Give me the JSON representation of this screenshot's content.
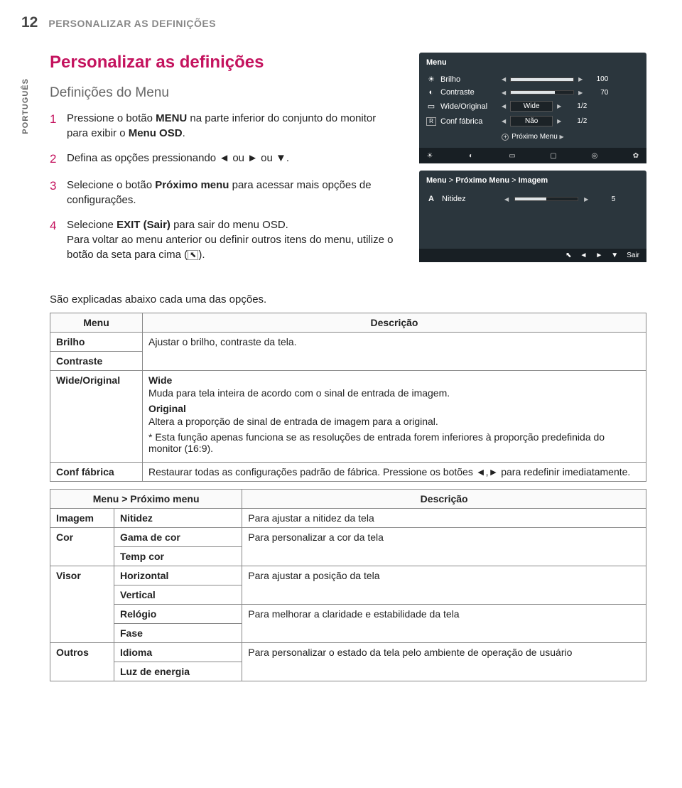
{
  "page": {
    "number": "12",
    "section": "PERSONALIZAR AS DEFINIÇÕES",
    "vertical_tab": "PORTUGUÊS"
  },
  "headings": {
    "main": "Personalizar as definições",
    "sub": "Definições do Menu"
  },
  "steps": {
    "s1": {
      "num": "1",
      "text_a": "Pressione o botão ",
      "btn": "MENU",
      "text_b": " na parte inferior do conjunto do monitor para exibir o ",
      "osd": "Menu OSD",
      "text_c": "."
    },
    "s2": {
      "num": "2",
      "text": "Defina as opções pressionando ◄ ou ► ou ▼."
    },
    "s3": {
      "num": "3",
      "text_a": "Selecione o botão ",
      "btn": "Próximo menu",
      "text_b": " para acessar mais opções de configurações."
    },
    "s4": {
      "num": "4",
      "text_a": "Selecione ",
      "btn": "EXIT (Sair)",
      "text_b": " para sair do menu OSD.",
      "text_c": "Para voltar ao menu anterior ou definir outros itens do menu, utilize o botão da seta para cima (",
      "text_d": ")."
    }
  },
  "osd1": {
    "title": "Menu",
    "rows": {
      "brilho": {
        "label": "Brilho",
        "value": "100",
        "fill_pct": 100
      },
      "contraste": {
        "label": "Contraste",
        "value": "70",
        "fill_pct": 70
      },
      "wide": {
        "label": "Wide/Original",
        "pill": "Wide",
        "value": "1/2"
      },
      "reset": {
        "icon": "R",
        "label": "Conf fábrica",
        "pill": "Não",
        "value": "1/2"
      }
    },
    "next": "Próximo Menu"
  },
  "osd2": {
    "crumb": {
      "a": "Menu",
      "b": "Próximo Menu",
      "c": "Imagem"
    },
    "row": {
      "icon": "A",
      "label": "Nitidez",
      "value": "5",
      "fill_pct": 50
    },
    "nav_exit": "Sair"
  },
  "lead": "São explicadas abaixo cada uma das opções.",
  "table1": {
    "headers": {
      "menu": "Menu",
      "desc": "Descrição"
    },
    "brilho": "Brilho",
    "contraste": "Contraste",
    "brightness_desc": "Ajustar o brilho, contraste da tela.",
    "wide": "Wide/Original",
    "wide_block": {
      "h1": "Wide",
      "p1": "Muda para tela inteira de acordo com o sinal de entrada de imagem.",
      "h2": "Original",
      "p2": "Altera a proporção de sinal de entrada de imagem para a original.",
      "p3": "* Esta função apenas funciona se as resoluções de entrada forem inferiores à proporção predefinida do monitor (16:9)."
    },
    "conf": "Conf fábrica",
    "conf_desc": "Restaurar todas as configurações padrão de fábrica. Pressione os botões ◄,► para redefinir imediatamente."
  },
  "table2": {
    "headers": {
      "menu": "Menu > Próximo menu",
      "desc": "Descrição"
    },
    "rows": {
      "imagem": {
        "cat": "Imagem",
        "s1": "Nitidez",
        "d": "Para ajustar a nitidez da tela"
      },
      "cor": {
        "cat": "Cor",
        "s1": "Gama de cor",
        "s2": "Temp cor",
        "d": "Para personalizar a cor da tela"
      },
      "visor": {
        "cat": "Visor",
        "s1": "Horizontal",
        "s2": "Vertical",
        "d1": "Para ajustar a posição da tela",
        "s3": "Relógio",
        "s4": "Fase",
        "d2": "Para melhorar a claridade e estabilidade da tela"
      },
      "outros": {
        "cat": "Outros",
        "s1": "Idioma",
        "s2": "Luz de energia",
        "d": "Para personalizar o estado da tela pelo ambiente de operação de usuário"
      }
    }
  }
}
